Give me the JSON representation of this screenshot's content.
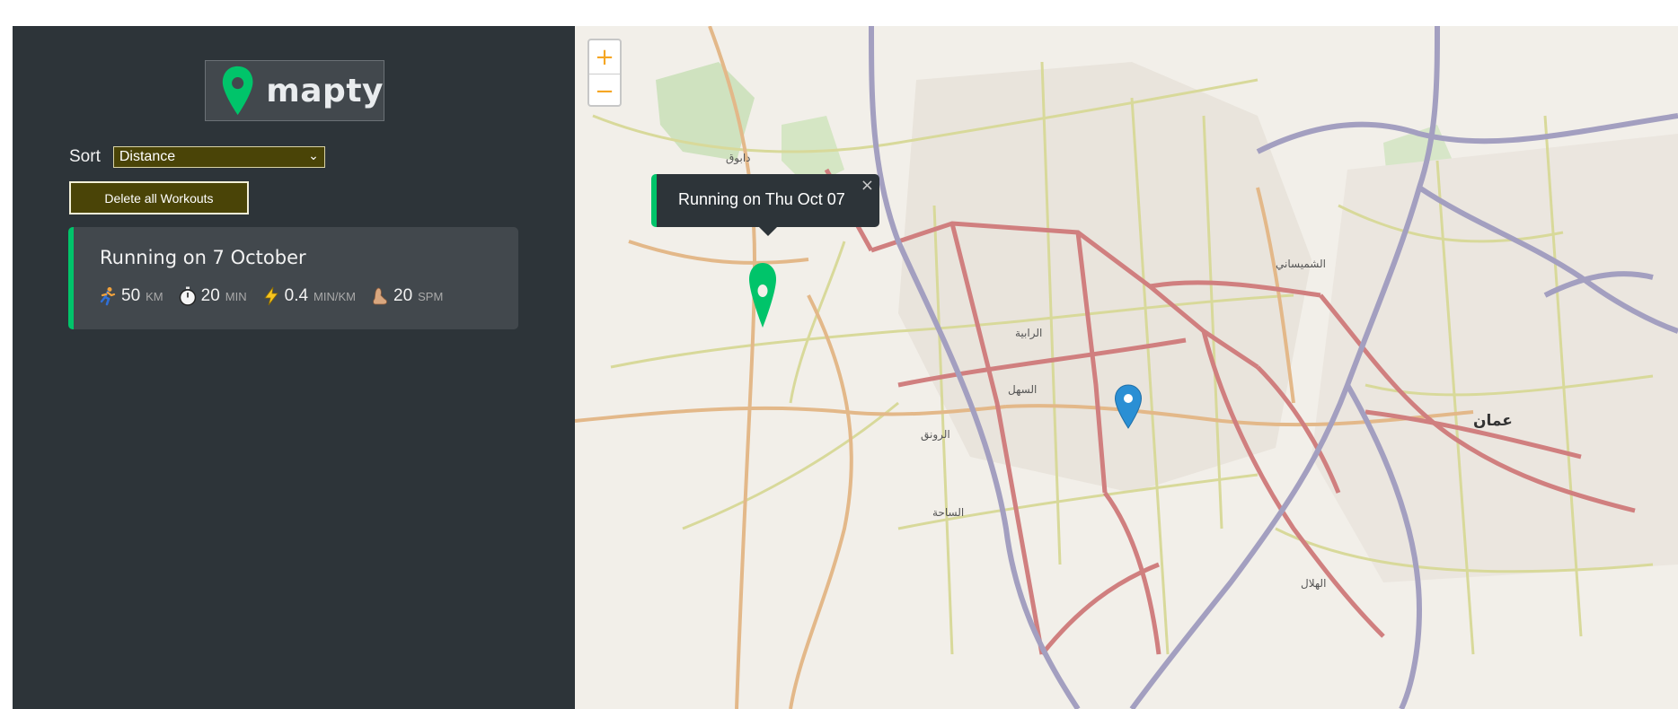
{
  "brand": {
    "name": "mapty",
    "accent": "#00c46a"
  },
  "sort": {
    "label": "Sort",
    "selected": "Distance"
  },
  "actions": {
    "delete_all": "Delete all Workouts"
  },
  "workouts": [
    {
      "title": "Running on 7 October",
      "type": "running",
      "details": [
        {
          "icon": "runner-icon",
          "value": "50",
          "unit": "KM"
        },
        {
          "icon": "stopwatch-icon",
          "value": "20",
          "unit": "MIN"
        },
        {
          "icon": "lightning-icon",
          "value": "0.4",
          "unit": "MIN/KM"
        },
        {
          "icon": "foot-icon",
          "value": "20",
          "unit": "SPM"
        }
      ]
    }
  ],
  "map": {
    "zoom_in": "+",
    "zoom_out": "−",
    "popup": {
      "text": "Running on Thu Oct 07",
      "close": "×"
    },
    "labels": {
      "amman": "عمان",
      "dabouq": "دابوق",
      "sahl": "السهل",
      "rabiyeh": "الرابية",
      "shmeisani": "الشميساني",
      "rawnaq": "الرونق",
      "sahaa": "الساحة",
      "hilal": "الهلال"
    }
  }
}
